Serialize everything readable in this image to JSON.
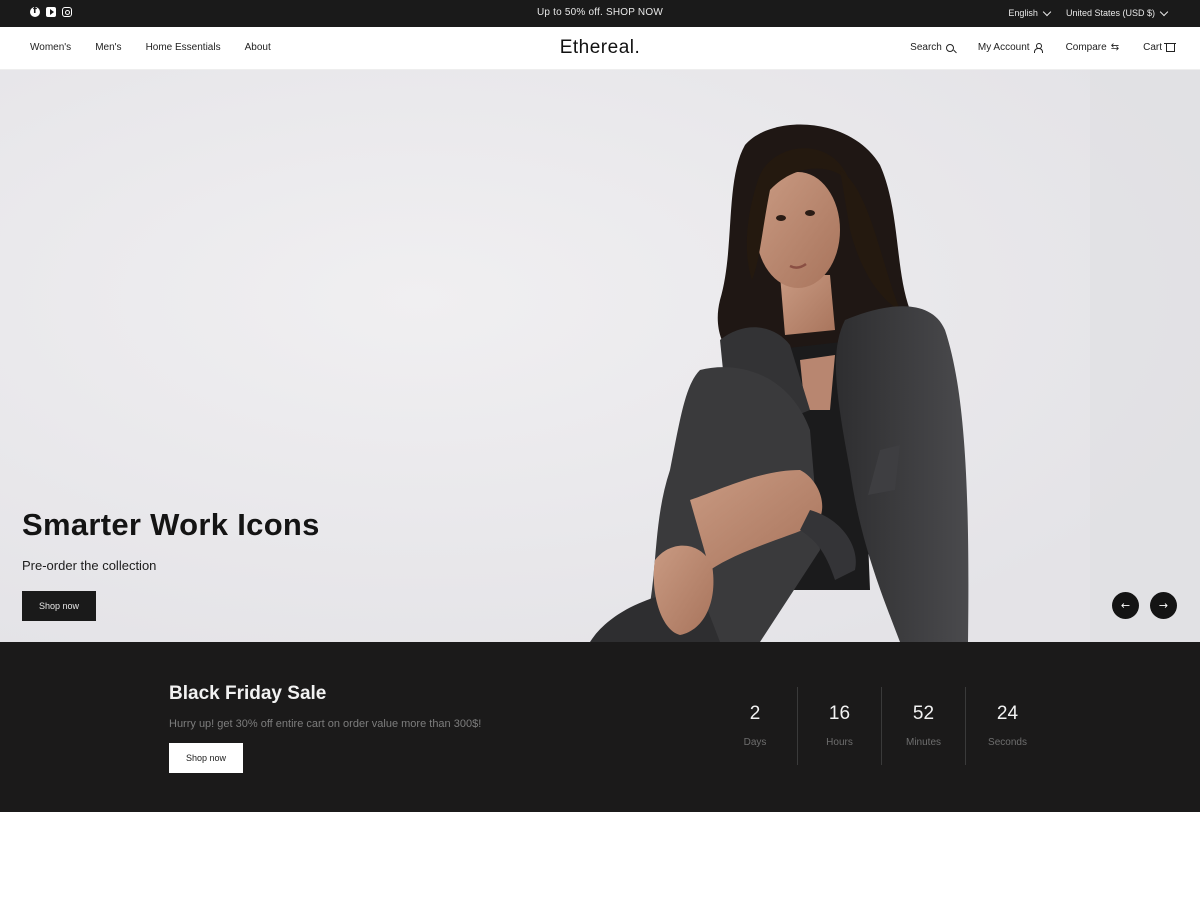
{
  "announcement": {
    "promo_text": "Up to 50% off. SHOP NOW",
    "social_icons": [
      "facebook-icon",
      "youtube-icon",
      "instagram-icon"
    ],
    "language": "English",
    "currency": "United States (USD $)"
  },
  "header": {
    "nav_left": [
      "Women's",
      "Men's",
      "Home Essentials",
      "About"
    ],
    "logo": "Ethereal.",
    "nav_right": {
      "search": "Search",
      "account": "My Account",
      "compare": "Compare",
      "cart": "Cart"
    }
  },
  "hero": {
    "title": "Smarter Work Icons",
    "subtitle": "Pre-order the collection",
    "cta": "Shop now",
    "prev_arrow": "←",
    "next_arrow": "→"
  },
  "sale": {
    "title": "Black Friday Sale",
    "text": "Hurry up! get 30% off entire cart on order value more than 300$!",
    "cta": "Shop now",
    "countdown": [
      {
        "value": "2",
        "label": "Days"
      },
      {
        "value": "16",
        "label": "Hours"
      },
      {
        "value": "52",
        "label": "Minutes"
      },
      {
        "value": "24",
        "label": "Seconds"
      }
    ]
  },
  "colors": {
    "dark": "#1a1a1a",
    "hero_bg": "#ebeaed",
    "muted": "#7d7d7d"
  }
}
